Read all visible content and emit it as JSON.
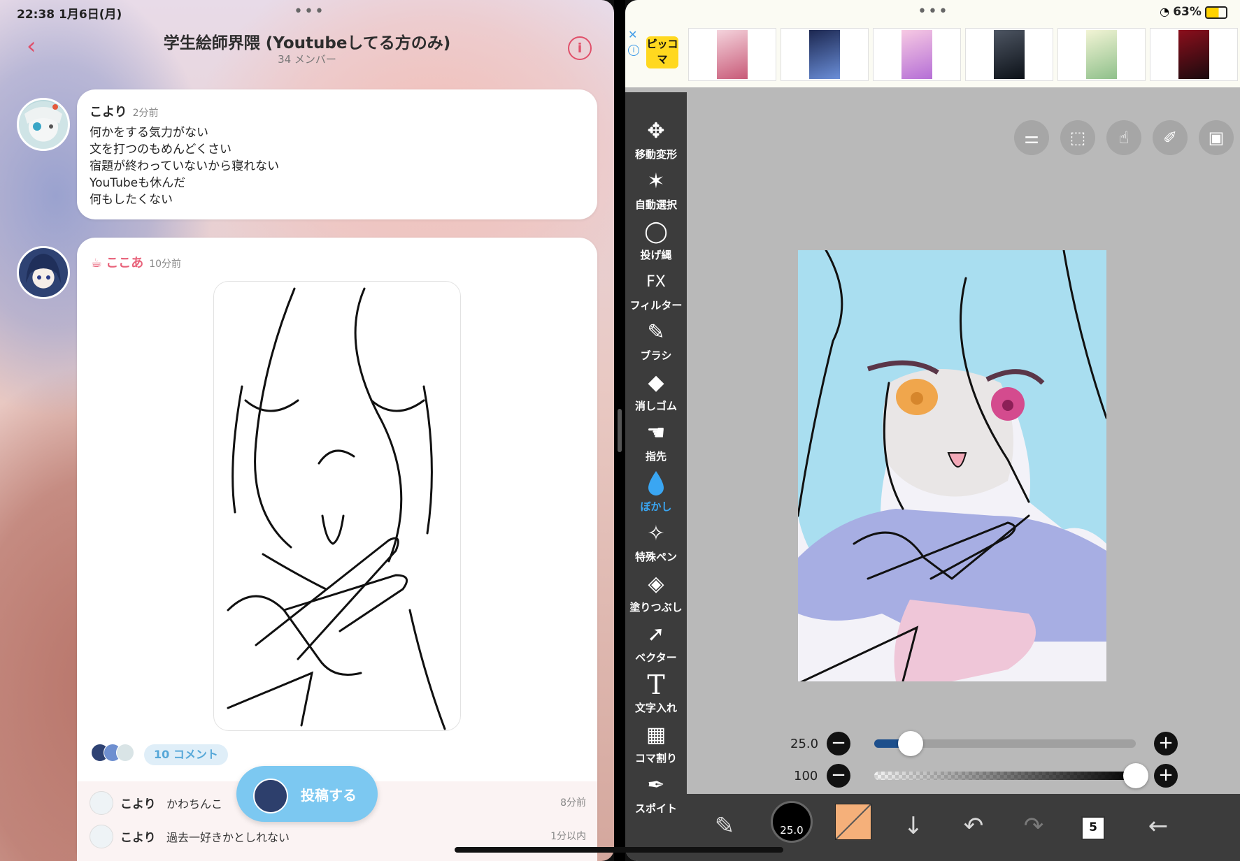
{
  "status": {
    "time_date": "22:38 1月6日(月)",
    "battery": "63%"
  },
  "chat": {
    "title": "学生絵師界隈 (Youtubeしてる方のみ)",
    "members": "34 メンバー",
    "message1": {
      "author": "こより",
      "time": "2分前",
      "lines": [
        "何かをする気力がない",
        "文を打つのもめんどくさい",
        "宿題が終わっていないから寝れない",
        "YouTubeも休んだ",
        "何もしたくない"
      ]
    },
    "message2": {
      "author": "ここあ",
      "time": "10分前",
      "comments": "10 コメント",
      "replies": [
        {
          "author": "こより",
          "text": "かわちんこ",
          "time": "8分前"
        },
        {
          "author": "こより",
          "text": "過去一好きかとしれない",
          "time": "1分以内"
        }
      ]
    },
    "post_button": "投稿する"
  },
  "ad": {
    "logo": "ピッコマ"
  },
  "app": {
    "tools": [
      {
        "label": "移動変形",
        "icon": "move-icon",
        "glyph": "✥"
      },
      {
        "label": "自動選択",
        "icon": "magic-wand-icon",
        "glyph": "✶"
      },
      {
        "label": "投げ縄",
        "icon": "lasso-icon",
        "glyph": "◯"
      },
      {
        "label": "フィルター",
        "icon": "filter-fx-icon",
        "glyph": "FX"
      },
      {
        "label": "ブラシ",
        "icon": "brush-icon",
        "glyph": "✎"
      },
      {
        "label": "消しゴム",
        "icon": "eraser-icon",
        "glyph": "◆"
      },
      {
        "label": "指先",
        "icon": "finger-smudge-icon",
        "glyph": "☚"
      },
      {
        "label": "ぼかし",
        "icon": "blur-drop-icon",
        "glyph": "💧"
      },
      {
        "label": "特殊ペン",
        "icon": "special-pen-icon",
        "glyph": "✧"
      },
      {
        "label": "塗りつぶし",
        "icon": "fill-bucket-icon",
        "glyph": "◈"
      },
      {
        "label": "ベクター",
        "icon": "vector-cursor-icon",
        "glyph": "➚"
      },
      {
        "label": "文字入れ",
        "icon": "text-tool-icon",
        "glyph": "T"
      },
      {
        "label": "コマ割り",
        "icon": "frame-divider-icon",
        "glyph": "▦"
      },
      {
        "label": "スポイト",
        "icon": "eyedropper-icon",
        "glyph": "✒"
      }
    ],
    "active_tool": "ぼかし",
    "brush_size": "25.0",
    "opacity": "100",
    "brush_size_ratio": 0.14,
    "opacity_ratio": 1.0,
    "brush_preview_value": "25.0",
    "layer_count": "5",
    "current_color": "#f5b07a",
    "accent_color": "#3aa6f2"
  }
}
